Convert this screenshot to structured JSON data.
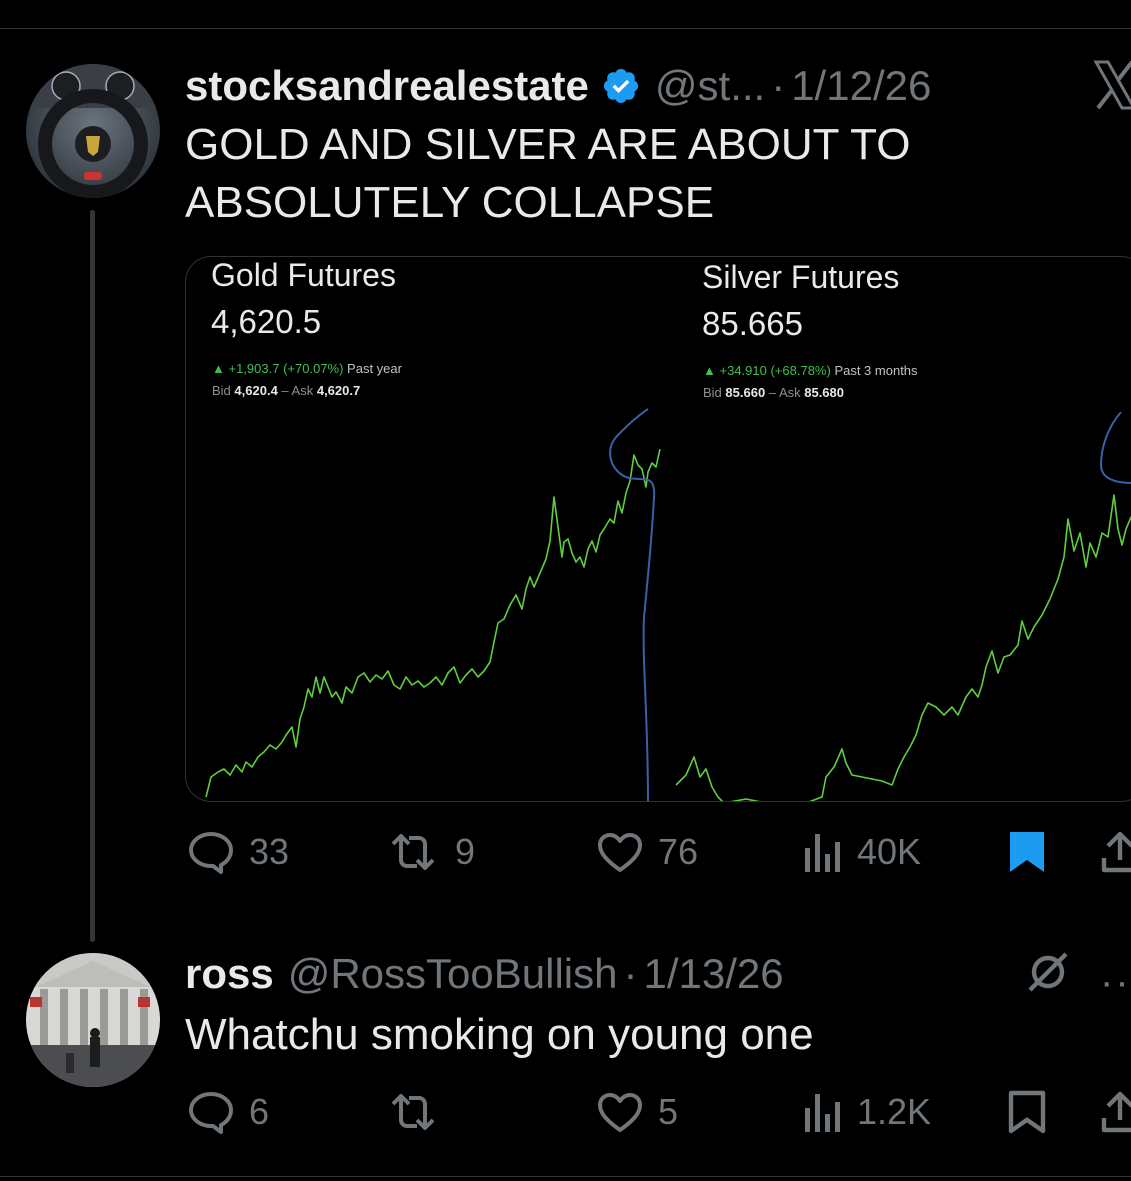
{
  "tweet1": {
    "display_name": "stocksandrealestate",
    "handle": "@st...",
    "date": "1/12/26",
    "text_line1": "GOLD AND SILVER ARE ABOUT TO",
    "text_line2": "ABSOLUTELY COLLAPSE",
    "media": {
      "gold": {
        "title": "Gold Futures",
        "price": "4,620.5",
        "change": "+1,903.7 (+70.07%)",
        "period": "Past year",
        "bid_label": "Bid",
        "bid": "4,620.4",
        "ask_label": "Ask",
        "ask": "4,620.7"
      },
      "silver": {
        "title": "Silver Futures",
        "price": "85.665",
        "change": "+34.910 (+68.78%)",
        "period": "Past 3 months",
        "bid_label": "Bid",
        "bid": "85.660",
        "ask_label": "Ask",
        "ask": "85.680"
      }
    },
    "actions": {
      "replies": "33",
      "reposts": "9",
      "likes": "76",
      "views": "40K"
    }
  },
  "tweet2": {
    "display_name": "ross",
    "handle": "@RossTooBullish",
    "date": "1/13/26",
    "text": "Whatchu smoking on young one",
    "actions": {
      "replies": "6",
      "reposts": "",
      "likes": "5",
      "views": "1.2K"
    }
  },
  "colors": {
    "background": "#000000",
    "text": "#e7e9ea",
    "muted": "#71767b",
    "verified_blue": "#1d9bf0",
    "chart_line": "#5fcf3f",
    "drawn_line": "#3b5fa8"
  },
  "icons": [
    "x-logo-icon",
    "verified-badge-icon",
    "reply-icon",
    "repost-icon",
    "like-icon",
    "views-icon",
    "bookmark-icon",
    "share-icon",
    "grok-icon",
    "more-icon"
  ]
}
